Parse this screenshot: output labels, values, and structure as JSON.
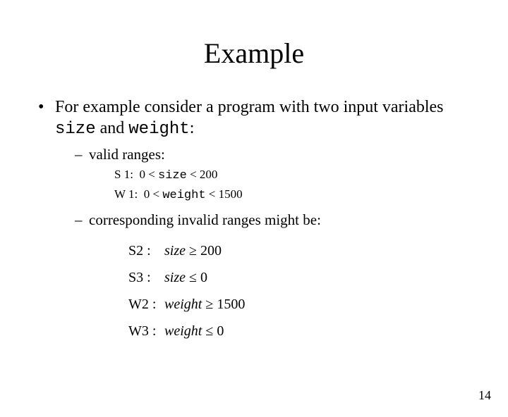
{
  "title": "Example",
  "bullet1_pre": "For example consider a program with two input variables ",
  "bullet1_code1": "size",
  "bullet1_mid": " and ",
  "bullet1_code2": "weight",
  "bullet1_post": ":",
  "sub1": "valid ranges:",
  "s1_label": "S 1:",
  "s1_a": "0 < ",
  "s1_code": "size",
  "s1_b": " < 200",
  "w1_label": "W 1:",
  "w1_a": "0 < ",
  "w1_code": "weight",
  "w1_b": " < 1500",
  "sub2": "corresponding invalid ranges might be:",
  "m_s2_lbl": "S2 :",
  "m_s2_var": "size",
  "m_s2_rel": " ≥ 200",
  "m_s3_lbl": "S3 :",
  "m_s3_var": "size",
  "m_s3_rel": " ≤ 0",
  "m_w2_lbl": "W2 :",
  "m_w2_var": "weight",
  "m_w2_rel": " ≥ 1500",
  "m_w3_lbl": "W3 :",
  "m_w3_var": "weight",
  "m_w3_rel": " ≤ 0",
  "page_number": "14"
}
